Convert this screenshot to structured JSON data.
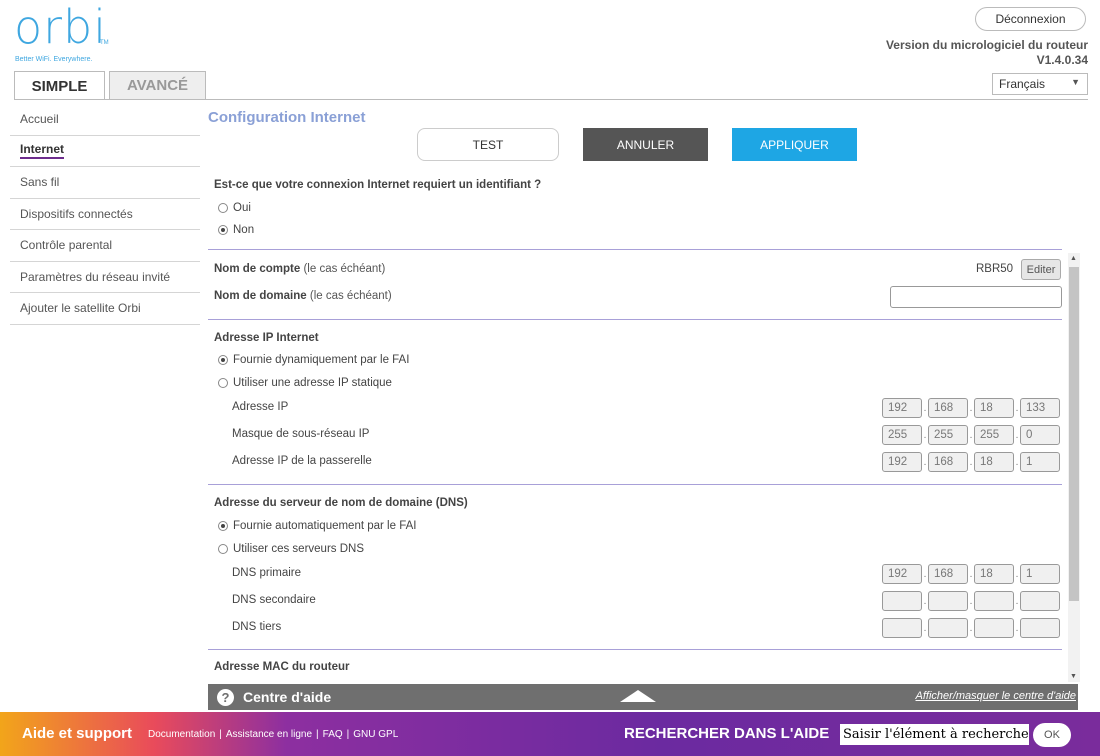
{
  "header": {
    "logo_text": "orbi",
    "logo_tm": "TM",
    "logo_tagline": "Better WiFi. Everywhere.",
    "logout_label": "Déconnexion",
    "firmware_label": "Version du micrologiciel du routeur",
    "firmware_version": "V1.4.0.34",
    "language": "Français",
    "tabs": [
      "SIMPLE",
      "AVANCÉ"
    ]
  },
  "sidebar": {
    "items": [
      "Accueil",
      "Internet",
      "Sans fil",
      "Dispositifs connectés",
      "Contrôle parental",
      "Paramètres du réseau invité",
      "Ajouter le satellite Orbi"
    ],
    "active": "Internet"
  },
  "main": {
    "title": "Configuration Internet",
    "buttons": {
      "test": "TEST",
      "cancel": "ANNULER",
      "apply": "APPLIQUER"
    },
    "login_question": "Est-ce que votre connexion Internet requiert un identifiant ?",
    "login_options": {
      "yes": "Oui",
      "no": "Non",
      "selected": "Non"
    },
    "account_name_label": "Nom de compte",
    "account_name_hint": "(le cas échéant)",
    "account_name_value": "RBR50",
    "edit_button": "Editer",
    "domain_name_label": "Nom de domaine",
    "domain_name_hint": "(le cas échéant)",
    "domain_name_value": "",
    "ip_section": {
      "title": "Adresse IP Internet",
      "opt_dynamic": "Fournie dynamiquement par le FAI",
      "opt_static": "Utiliser une adresse IP statique",
      "selected": "dynamic",
      "ip_label": "Adresse IP",
      "ip": [
        "192",
        "168",
        "18",
        "133"
      ],
      "mask_label": "Masque de sous-réseau IP",
      "mask": [
        "255",
        "255",
        "255",
        "0"
      ],
      "gateway_label": "Adresse IP de la passerelle",
      "gateway": [
        "192",
        "168",
        "18",
        "1"
      ]
    },
    "dns_section": {
      "title": "Adresse du serveur de nom de domaine (DNS)",
      "opt_auto": "Fournie automatiquement par le FAI",
      "opt_manual": "Utiliser ces serveurs DNS",
      "selected": "auto",
      "primary_label": "DNS primaire",
      "primary": [
        "192",
        "168",
        "18",
        "1"
      ],
      "secondary_label": "DNS secondaire",
      "secondary": [
        "",
        "",
        "",
        ""
      ],
      "tertiary_label": "DNS tiers",
      "tertiary": [
        "",
        "",
        "",
        ""
      ]
    },
    "mac_section_title": "Adresse MAC du routeur"
  },
  "help_bar": {
    "icon": "?",
    "title": "Centre d'aide",
    "toggle_label": "Afficher/masquer le centre d'aide"
  },
  "footer": {
    "title": "Aide et support",
    "links": [
      "Documentation",
      "Assistance en ligne",
      "FAQ",
      "GNU GPL"
    ],
    "search_label": "RECHERCHER DANS L'AIDE",
    "search_placeholder": "Saisir l'élément à rechercher",
    "ok_label": "OK"
  },
  "colors": {
    "accent_blue": "#1ea6e4",
    "title_blue": "#8aa0d6",
    "footer_purple": "#6b2aa0",
    "active_underline": "#6c2c8c"
  },
  "icons": [
    "question-mark-icon",
    "triangle-up-icon",
    "chevron-down-icon",
    "scroll-up-icon",
    "scroll-down-icon"
  ]
}
